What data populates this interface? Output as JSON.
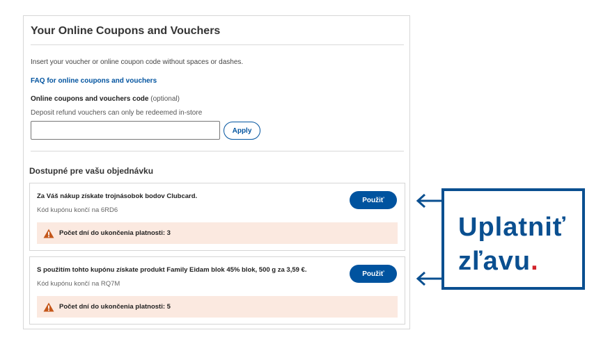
{
  "panel": {
    "title": "Your Online Coupons and Vouchers",
    "instruction": "Insert your voucher or online coupon code without spaces or dashes.",
    "faq_link": "FAQ for online coupons and vouchers",
    "code_label": "Online coupons and vouchers code",
    "code_label_optional": "(optional)",
    "deposit_note": "Deposit refund vouchers can only be redeemed in-store",
    "code_input": {
      "value": "",
      "placeholder": ""
    },
    "apply_label": "Apply"
  },
  "available": {
    "heading": "Dostupné pre vašu objednávku",
    "coupons": [
      {
        "description": "Za Váš nákup získate trojnásobok bodov Clubcard.",
        "code_text": "Kód kupónu končí na 6RD6",
        "button_label": "Použiť",
        "warning": "Počet dní do ukončenia platnosti: 3"
      },
      {
        "description": "S použitím tohto kupónu získate produkt Family Eidam blok 45% blok, 500 g za 3,59 €.",
        "code_text": "Kód kupónu končí na RQ7M",
        "button_label": "Použiť",
        "warning": "Počet dní do ukončenia platnosti: 5"
      }
    ]
  },
  "callout": {
    "line1": "Uplatniť",
    "line2": "zľavu",
    "dot": "."
  },
  "colors": {
    "brand_blue": "#00539f",
    "callout_blue": "#0a4f90",
    "warning_bg": "#fbe9e0",
    "warning_icon": "#c4571a",
    "accent_red": "#d2232a"
  },
  "icons": {
    "warning": "warning-triangle-icon",
    "arrow": "arrow-left-icon"
  }
}
